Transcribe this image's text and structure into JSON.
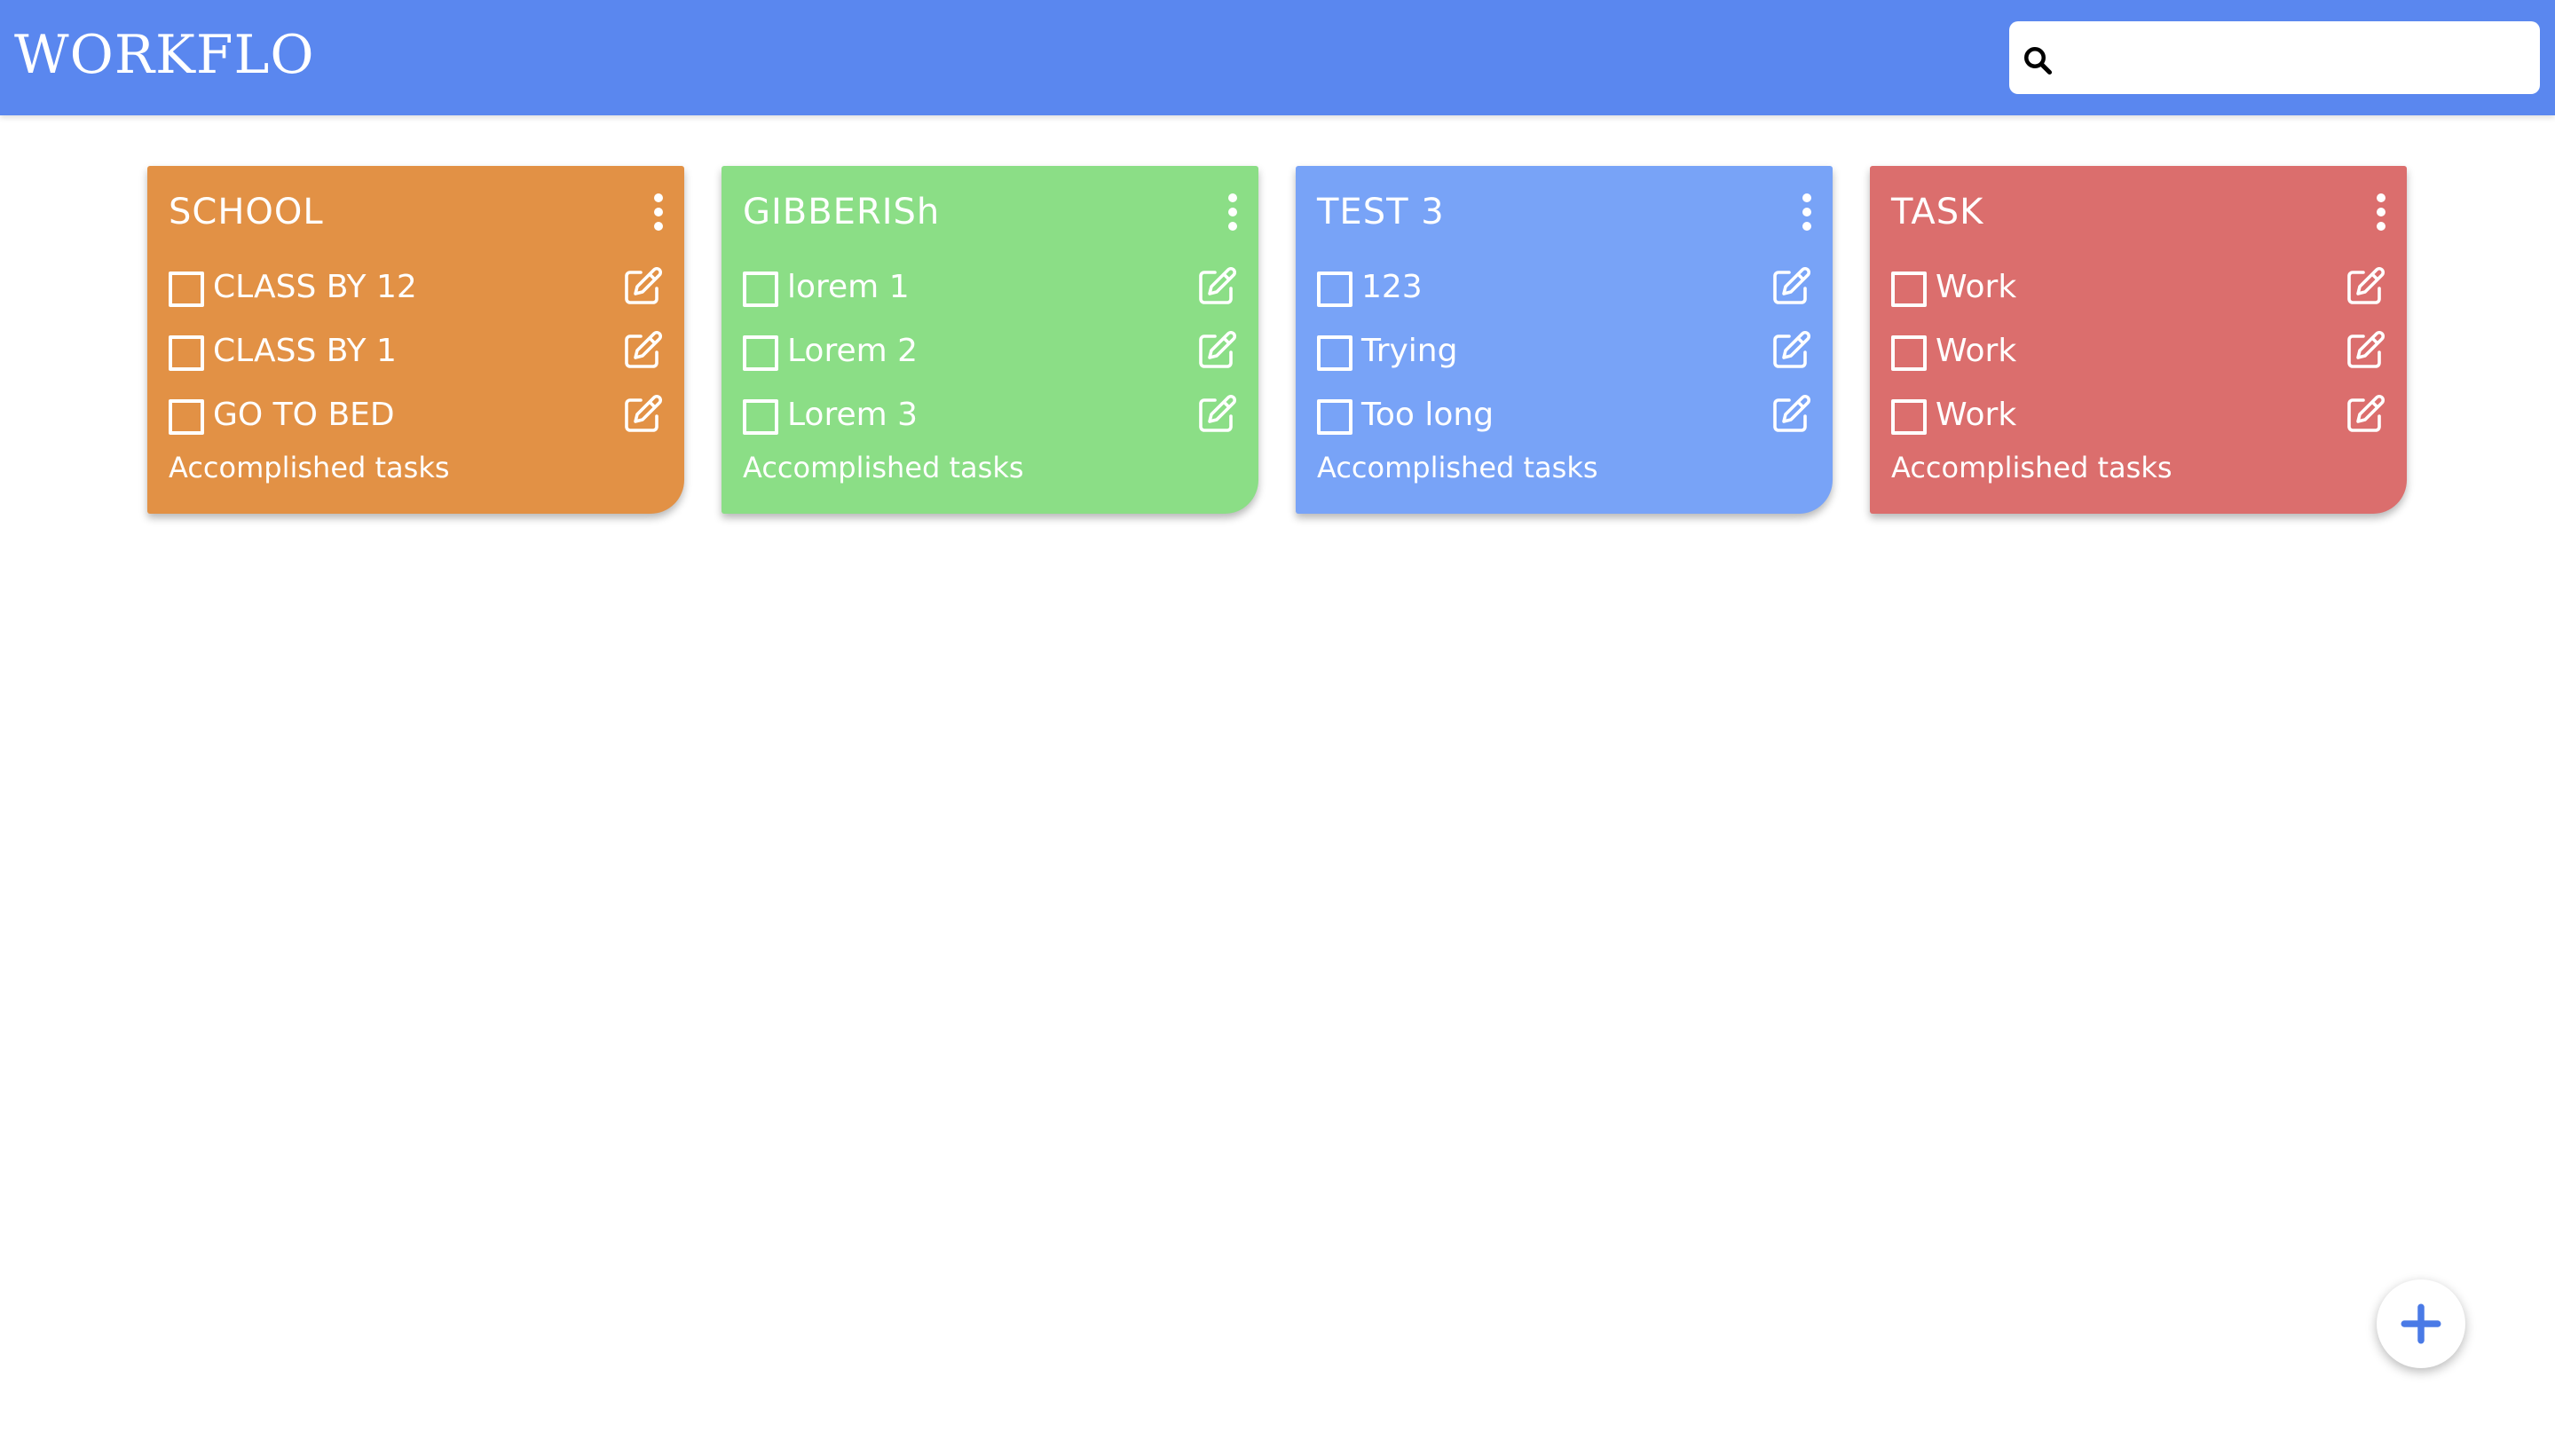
{
  "app": {
    "title": "WORKFLO"
  },
  "search": {
    "icon": "search-icon",
    "value": "",
    "placeholder": ""
  },
  "colors": {
    "header": "#5a87ef",
    "fab_plus": "#4a7ae6"
  },
  "cards": [
    {
      "title": "SCHOOL",
      "color": "#e29145",
      "tasks": [
        {
          "label": "CLASS BY 12",
          "checked": false
        },
        {
          "label": "CLASS BY 1",
          "checked": false
        },
        {
          "label": "GO TO BED",
          "checked": false
        }
      ],
      "footer": "Accomplished tasks"
    },
    {
      "title": "GIBBERISh",
      "color": "#8bde86",
      "tasks": [
        {
          "label": "lorem 1",
          "checked": false
        },
        {
          "label": "Lorem 2",
          "checked": false
        },
        {
          "label": "Lorem 3",
          "checked": false
        }
      ],
      "footer": "Accomplished tasks"
    },
    {
      "title": "TEST 3",
      "color": "#78a3f7",
      "tasks": [
        {
          "label": "123",
          "checked": false
        },
        {
          "label": "Trying",
          "checked": false
        },
        {
          "label": "Too long",
          "checked": false
        }
      ],
      "footer": "Accomplished tasks"
    },
    {
      "title": "TASK",
      "color": "#db6e6d",
      "tasks": [
        {
          "label": "Work",
          "checked": false
        },
        {
          "label": "Work",
          "checked": false
        },
        {
          "label": "Work",
          "checked": false
        }
      ],
      "footer": "Accomplished tasks"
    }
  ],
  "fab": {
    "icon": "plus-icon"
  }
}
